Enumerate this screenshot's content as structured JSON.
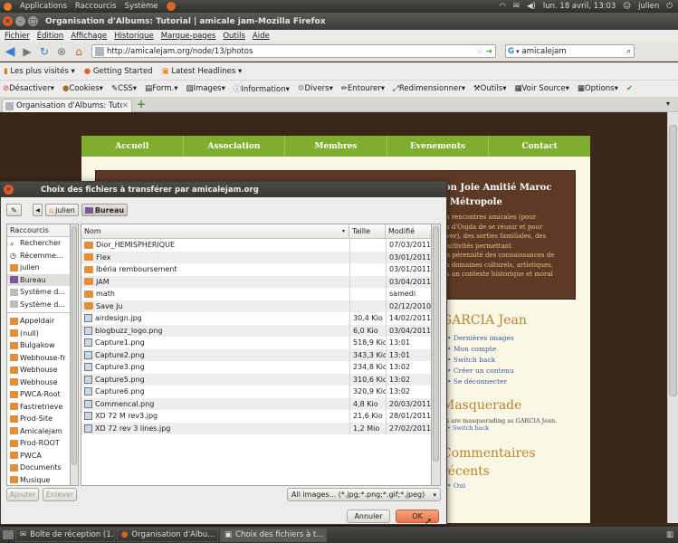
{
  "panel": {
    "menus": [
      "Applications",
      "Raccourcis",
      "Système"
    ],
    "clock": "lun. 18 avril, 13:03",
    "user": "julien"
  },
  "window": {
    "title": "Organisation d'Albums: Tutorial | amicale jam-Mozilla Firefox"
  },
  "menubar": {
    "items": [
      "Fichier",
      "Édition",
      "Affichage",
      "Historique",
      "Marque-pages",
      "Outils",
      "Aide"
    ]
  },
  "navbar": {
    "url": "http://amicalejam.org/node/13/photos",
    "search": "amicalejam"
  },
  "bookmarks": {
    "items": [
      "Les plus visités",
      "Getting Started",
      "Latest Headlines"
    ]
  },
  "devbar": {
    "items": [
      "Désactiver",
      "Cookies",
      "CSS",
      "Form.",
      "Images",
      "Information",
      "Divers",
      "Entourer",
      "Redimensionner",
      "Outils",
      "Voir Source",
      "Options"
    ]
  },
  "tabs": [
    {
      "label": "Organisation d'Albums: Tutori..."
    }
  ],
  "site": {
    "nav": [
      "Accueil",
      "Association",
      "Membres",
      "Evenements",
      "Contact"
    ],
    "banner_title_1": "on Joie Amitié Maroc",
    "banner_title_2": "Métropole",
    "banner_text": [
      "s rencontres amicales (pour",
      "s d'Oujda de se réunir et pour",
      "ver), des sorties familiales, des",
      "activités permettant",
      "a pérennité des connaissances de",
      "s domaines culturels, artistiques,",
      "s un contexte historique et moral"
    ],
    "user_heading": "GARCIA Jean",
    "user_links": [
      "Dernières images",
      "Mon compte",
      "Switch back",
      "Créer un contenu",
      "Se déconnecter"
    ],
    "masq_heading": "Masquerade",
    "masq_text": "ou are masquerading as GARCIA Jean.",
    "masq_link": "Switch back",
    "comments_heading_1": "Commentaires",
    "comments_heading_2": "récents",
    "comments_link": "Oui"
  },
  "dialog": {
    "title": "Choix des fichiers à transférer par amicalejam.org",
    "crumbs": [
      "julien",
      "Bureau"
    ],
    "places_header": "Raccourcis",
    "places": [
      "Rechercher",
      "Récemme...",
      "julien",
      "Bureau",
      "Système d...",
      "Système d...",
      "Appeldair",
      "(null)",
      "Bulgakow",
      "Webhouse-fr",
      "Webhouse",
      "Webhouse",
      "PWCA-Root",
      "Fastretrieve",
      "Prod-Site",
      "Amicalejam",
      "Prod-ROOT",
      "PWCA",
      "Documents",
      "Musique"
    ],
    "columns": {
      "name": "Nom",
      "size": "Taille",
      "modified": "Modifié"
    },
    "files": [
      {
        "name": "Dior_HEMISPHERIQUE",
        "size": "",
        "date": "07/03/2011",
        "type": "folder"
      },
      {
        "name": "Flex",
        "size": "",
        "date": "03/01/2011",
        "type": "folder"
      },
      {
        "name": "Ibéria remboursement",
        "size": "",
        "date": "03/01/2011",
        "type": "folder"
      },
      {
        "name": "JAM",
        "size": "",
        "date": "03/04/2011",
        "type": "folder"
      },
      {
        "name": "math",
        "size": "",
        "date": "samedi",
        "type": "folder"
      },
      {
        "name": "Save Ju",
        "size": "",
        "date": "02/12/2010",
        "type": "folder"
      },
      {
        "name": "airdesign.jpg",
        "size": "30,4 Kio",
        "date": "14/02/2011",
        "type": "image"
      },
      {
        "name": "blogbuzz_logo.png",
        "size": "6,0 Kio",
        "date": "03/04/2011",
        "type": "image"
      },
      {
        "name": "Capture1.png",
        "size": "518,9 Kio",
        "date": "13:01",
        "type": "image"
      },
      {
        "name": "Capture2.png",
        "size": "343,3 Kio",
        "date": "13:01",
        "type": "image"
      },
      {
        "name": "Capture3.png",
        "size": "234,8 Kio",
        "date": "13:02",
        "type": "image"
      },
      {
        "name": "Capture5.png",
        "size": "310,6 Kio",
        "date": "13:02",
        "type": "image"
      },
      {
        "name": "Capture6.png",
        "size": "320,9 Kio",
        "date": "13:02",
        "type": "image"
      },
      {
        "name": "Commencal.png",
        "size": "4,8 Kio",
        "date": "20/03/2011",
        "type": "image"
      },
      {
        "name": "XD 72 M rev3.jpg",
        "size": "21,6 Kio",
        "date": "28/01/2011",
        "type": "image"
      },
      {
        "name": "XD 72 rev 3 lines.jpg",
        "size": "1,2 Mio",
        "date": "27/02/2011",
        "type": "image"
      }
    ],
    "add_label": "Ajouter",
    "remove_label": "Enlever",
    "filter": "All images... (*.jpg;*.png;*.gif;*.jpeg)",
    "cancel_label": "Annuler",
    "ok_label": "OK"
  },
  "taskbar": {
    "items": [
      "Boîte de réception (1...",
      "Organisation d'Albu...",
      "Choix des fichiers à t..."
    ]
  }
}
